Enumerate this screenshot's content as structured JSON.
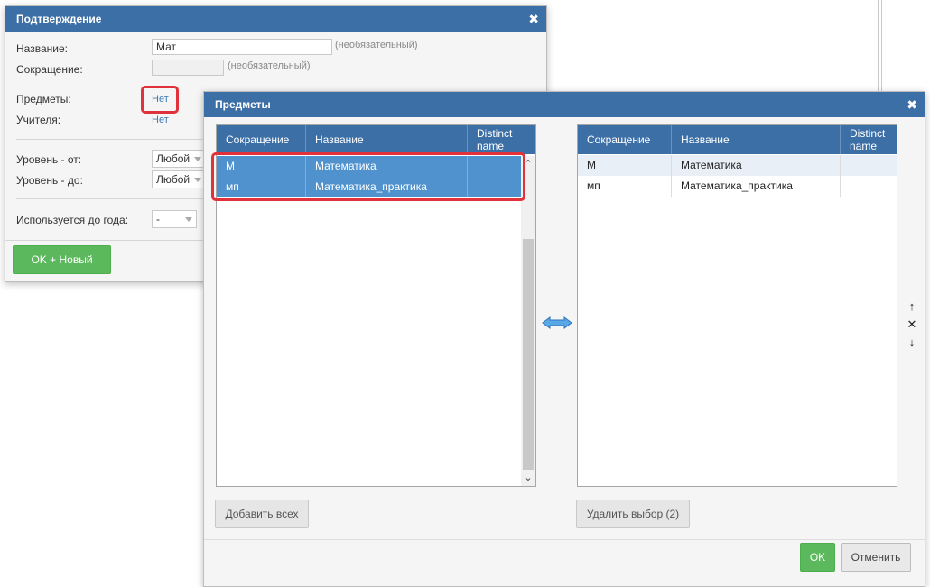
{
  "confirm_dialog": {
    "title": "Подтверждение",
    "close": "✖",
    "name_label": "Название:",
    "name_value": "Мат",
    "optional_hint": "(необязательный)",
    "abbr_label": "Сокращение:",
    "abbr_value": "",
    "subjects_label": "Предметы:",
    "subjects_link": "Нет",
    "teachers_label": "Учителя:",
    "teachers_link": "Нет",
    "level_from_label": "Уровень - от:",
    "level_from_value": "Любой",
    "level_to_label": "Уровень - до:",
    "level_to_value": "Любой",
    "used_until_label": "Используется до года:",
    "used_until_value": "-",
    "ok_new_button": "OK + Новый"
  },
  "subjects_dialog": {
    "title": "Предметы",
    "close": "✖",
    "columns": [
      "Сокращение",
      "Название",
      "Distinct name"
    ],
    "available_rows": [
      {
        "abbr": "М",
        "name": "Математика",
        "distinct": ""
      },
      {
        "abbr": "мп",
        "name": "Математика_практика",
        "distinct": ""
      }
    ],
    "selected_rows": [
      {
        "abbr": "М",
        "name": "Математика",
        "distinct": ""
      },
      {
        "abbr": "мп",
        "name": "Математика_практика",
        "distinct": ""
      }
    ],
    "transfer_icon": "double-arrow-icon",
    "add_all_button": "Добавить всех",
    "remove_selection_button": "Удалить выбор (2)",
    "move_up": "↑",
    "remove": "✕",
    "move_down": "↓",
    "ok_button": "OK",
    "cancel_button": "Отменить"
  },
  "colors": {
    "titlebar": "#3c6fa6",
    "selected_row": "#4f92cd",
    "ok_green": "#5cb85c",
    "highlight_red": "#e1323c",
    "link": "#3d7ab5"
  }
}
